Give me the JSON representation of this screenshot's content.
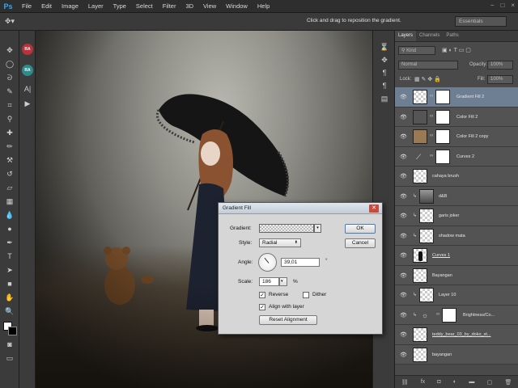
{
  "app": {
    "logo": "Ps"
  },
  "menu": {
    "items": [
      "File",
      "Edit",
      "Image",
      "Layer",
      "Type",
      "Select",
      "Filter",
      "3D",
      "View",
      "Window",
      "Help"
    ]
  },
  "window_controls": [
    "−",
    "□",
    "×"
  ],
  "options": {
    "hint": "Click and drag to reposition the gradient.",
    "workspace": "Essentials"
  },
  "actions_dock": {
    "items": [
      {
        "label": "RA",
        "color": "#b8323a"
      },
      {
        "label": "RA",
        "color": "#2d8b8b"
      }
    ]
  },
  "layers_panel": {
    "tabs": [
      "Layers",
      "Channels",
      "Paths"
    ],
    "kind_filter": "Kind",
    "blend_mode": "Normal",
    "opacity_label": "Opacity:",
    "opacity_value": "100%",
    "lock_label": "Lock:",
    "fill_label": "Fill:",
    "fill_value": "100%",
    "layers": [
      {
        "name": "Gradient Fill 2",
        "selected": true,
        "thumb": "checker",
        "mask": true,
        "visible": true
      },
      {
        "name": "Color Fill 2",
        "thumb": "#555555",
        "mask": true,
        "visible": true
      },
      {
        "name": "Color Fill 2 copy",
        "thumb": "#9a7a52",
        "mask": true,
        "visible": true
      },
      {
        "name": "Curves 2",
        "thumb": "curves",
        "mask": true,
        "visible": true
      },
      {
        "name": "cahaya brush",
        "thumb": "checker",
        "visible": true
      },
      {
        "name": "d&B",
        "thumb": "photo",
        "clipped": true,
        "visible": true
      },
      {
        "name": "garis joker",
        "thumb": "checker",
        "clipped": true,
        "visible": true
      },
      {
        "name": "shadow mata",
        "thumb": "checker",
        "clipped": true,
        "visible": true
      },
      {
        "name": "Curves 1",
        "thumb": "figure",
        "visible": true
      },
      {
        "name": "Bayangan",
        "thumb": "checker",
        "visible": true
      },
      {
        "name": "Layer 10",
        "thumb": "checker",
        "clipped": true,
        "visible": true
      },
      {
        "name": "Brightness/Co...",
        "thumb": "brightness",
        "clipped": true,
        "mask": true,
        "visible": true
      },
      {
        "name": "teddy_bear_03_by_doko_st...",
        "thumb": "checker",
        "visible": true
      },
      {
        "name": "bayangan",
        "thumb": "checker",
        "visible": true
      }
    ],
    "footer_icons": [
      "link-icon",
      "fx-icon",
      "mask-icon",
      "adjustment-icon",
      "folder-icon",
      "new-layer-icon",
      "trash-icon"
    ]
  },
  "dialog": {
    "title": "Gradient Fill",
    "gradient_label": "Gradient:",
    "style_label": "Style:",
    "style_value": "Radial",
    "angle_label": "Angle:",
    "angle_value": "39,01",
    "degree_symbol": "°",
    "scale_label": "Scale:",
    "scale_value": "186",
    "percent_symbol": "%",
    "reverse_label": "Reverse",
    "reverse_checked": true,
    "dither_label": "Dither",
    "dither_checked": false,
    "align_label": "Align with layer",
    "align_checked": true,
    "reset_label": "Reset Alignment",
    "ok_label": "OK",
    "cancel_label": "Cancel"
  }
}
